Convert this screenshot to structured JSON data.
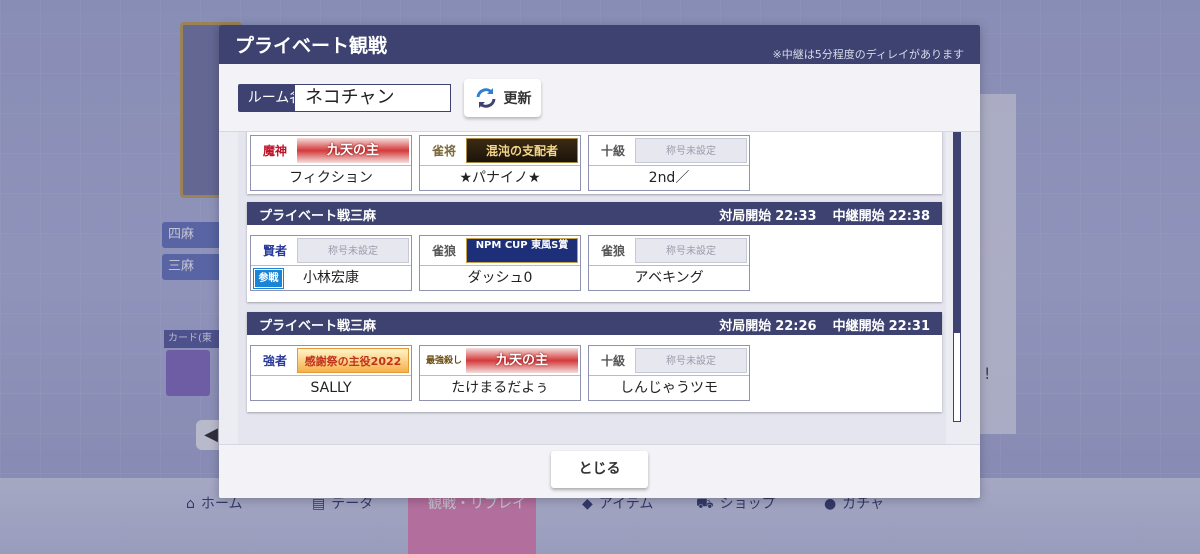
{
  "background": {
    "mode_labels": [
      "四麻",
      "三麻"
    ],
    "card_label": "カード(東",
    "nav": [
      "ホーム",
      "データ",
      "観戦・リプレイ",
      "アイテム",
      "ショップ",
      "ガチャ"
    ]
  },
  "modal": {
    "title": "プライベート観戦",
    "note": "※中継は5分程度のディレイがあります",
    "room_label": "ルーム名",
    "room_value": "ネコチャン",
    "refresh_label": "更新",
    "close_label": "とじる"
  },
  "rooms": [
    {
      "name": "",
      "start_label": "",
      "start": "",
      "relay_label": "",
      "relay": "",
      "players": [
        {
          "rank": "魔神",
          "title": "九天の主",
          "title_style": "red",
          "name": "フィクション"
        },
        {
          "rank": "雀将",
          "title": "混沌の支配者",
          "title_style": "gold",
          "name": "★パナイノ★"
        },
        {
          "rank": "十級",
          "title": "称号未設定",
          "title_style": "unset",
          "name": "2nd／"
        }
      ]
    },
    {
      "name": "プライベート戦三麻",
      "start_label": "対局開始",
      "start": "22:33",
      "relay_label": "中継開始",
      "relay": "22:38",
      "players": [
        {
          "rank": "賢者",
          "title": "称号未設定",
          "title_style": "unset",
          "name": "小林宏康",
          "badge": "参戦"
        },
        {
          "rank": "雀狼",
          "title": "NPM CUP 東風S賞",
          "title_style": "navy",
          "name": "ダッシュ0"
        },
        {
          "rank": "雀狼",
          "title": "称号未設定",
          "title_style": "unset",
          "name": "アベキング"
        }
      ]
    },
    {
      "name": "プライベート戦三麻",
      "start_label": "対局開始",
      "start": "22:26",
      "relay_label": "中継開始",
      "relay": "22:31",
      "players": [
        {
          "rank": "強者",
          "title": "感謝祭の主役2022",
          "title_style": "orange",
          "name": "SALLY"
        },
        {
          "rank": "最強殺し",
          "title": "九天の主",
          "title_style": "red",
          "name": "たけまるだよぅ"
        },
        {
          "rank": "十級",
          "title": "称号未設定",
          "title_style": "unset",
          "name": "しんじゃうツモ"
        }
      ]
    }
  ],
  "colors": {
    "navy": "#3d4270",
    "badge": "#1a84d6",
    "nav_active": "#e88ab7"
  }
}
